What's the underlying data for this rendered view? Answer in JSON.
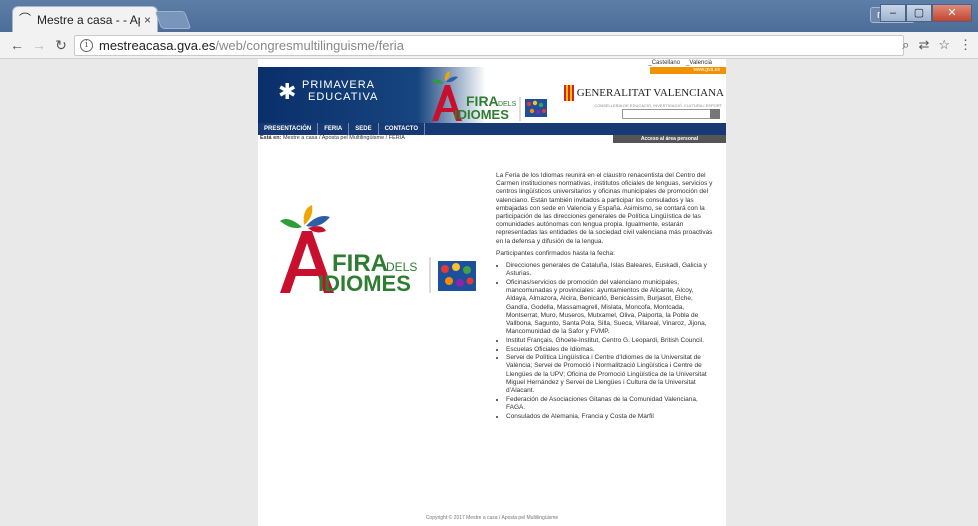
{
  "browser": {
    "tab_title": "Mestre a casa - - Aposta",
    "tab_close": "×",
    "profile_name": "marya",
    "url_host": "mestreacasa.gva.es",
    "url_path": "/web/congresmultilinguisme/feria",
    "icons": [
      "back-arrow-icon",
      "forward-arrow-icon",
      "reload-icon",
      "info-icon",
      "zoom-icon",
      "translate-icon",
      "star-icon",
      "menu-icon"
    ]
  },
  "header": {
    "lang_castellano": "_Castellano",
    "lang_valencia": "_Valencià",
    "pe_line1": "PRIMAVERA",
    "pe_line2": "EDUCATIVA",
    "fira_line1": "FIRA",
    "fira_dels": "DELS",
    "fira_line2": "IDIOMES",
    "gva_url": "www.gva.es",
    "gva_name": "GENERALITAT VALENCIANA",
    "gva_sub": "CONSELLERIA DE EDUCACIÓ, INVESTIGACIÓ, CULTURA I ESPORT"
  },
  "nav": {
    "items": [
      "PRESENTACIÓN",
      "FERIA",
      "SEDE",
      "CONTACTO"
    ],
    "access": "Acceso al área personal"
  },
  "breadcrumb": {
    "prefix": "Está en:",
    "path": "Mestre a casa / Aposta pel Multilingüisme / FERIA"
  },
  "content": {
    "intro": "La Feria de los Idiomas reunirá en el claustro renacentista del Centro del Carmen instituciones normativas, institutos oficiales de lenguas, servicios y centros lingüísticos universitarios y oficinas municipales de promoción del valenciano. Están también invitados a participar los consulados y las embajadas con sede en Valencia y España. Asimismo, se contará con la participación de las direcciones generales de Política Lingüística de las comunidades autónomas con lengua propia. Igualmente, estarán representadas las entidades de la sociedad civil valenciana más proactivas en la defensa y difusión de la lengua.",
    "participants_heading": "Participantes confirmados hasta la fecha:",
    "participants": [
      "Direcciones generales de Cataluña, Islas Baleares, Euskadi, Galicia y Asturias.",
      "Oficinas/servicios de promoción del valenciano municipales, mancomunadas y provinciales: ayuntamientos de Alicante, Alcoy, Aldaya, Almazora, Alcira, Benicarló, Benicàssim, Burjasot, Elche, Gandía, Godella, Massamagrell, Mislata, Moncofa, Montcada, Montserrat, Muro, Museros, Mutxamel, Oliva, Paiporta, la Pobla de Vallbona, Sagunto, Santa Pola, Silla, Sueca, Villareal, Vinaroz, Jijona, Mancomunidad de la Safor y FVMP.",
      "Institut Français, Ghoete-Institut, Centro G. Leopardi, British Council.",
      "Escuelas Oficiales de Idiomas.",
      "Servei de Política Lingüística i Centre d'Idiomes de la Universitat de València; Servei de Promoció i Normalització Lingüística i Centre de Llengües de la UPV; Oficina de Promoció Lingüística de la Universitat Miguel Hernández y Servei de Llengües i Cultura de la Universitat d'Alacant.",
      "Federación de Asociaciones Gitanas de la Comunidad Valenciana, FAGA.",
      "Consulados de Alemania, Francia y Costa de Marfil"
    ]
  },
  "footer": {
    "text": "Copyright © 2017 Mestre a casa / Aposta pel Multilingüisme"
  },
  "colors": {
    "navy": "#173a74",
    "fira_red": "#c8102e",
    "gva_orange": "#f39200"
  }
}
